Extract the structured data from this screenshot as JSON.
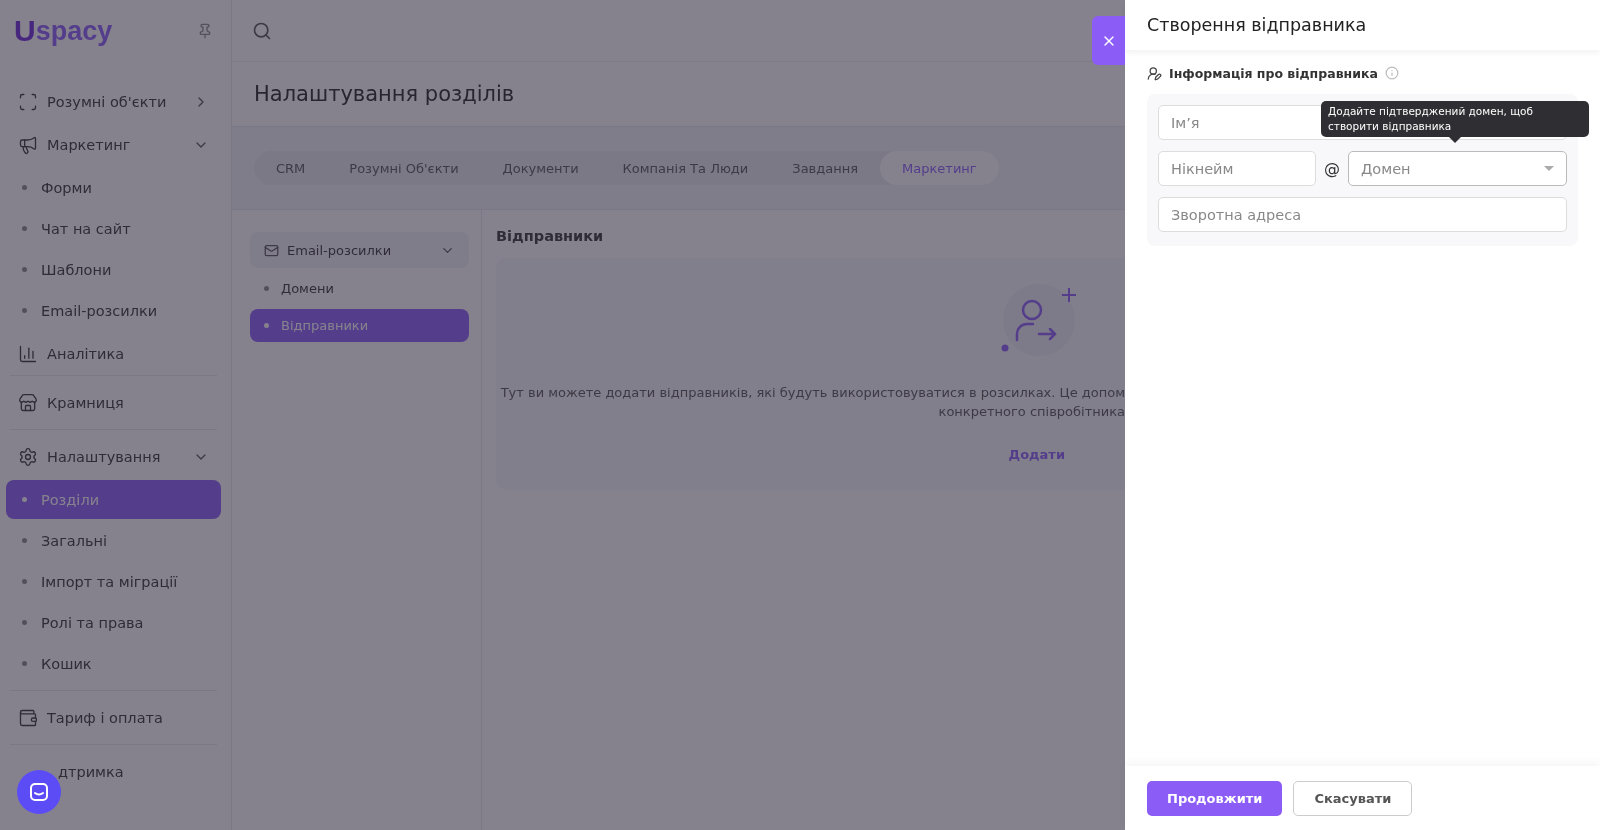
{
  "sidebar": {
    "logo": {
      "mark": "U",
      "text": "spacy"
    },
    "groups": [
      [
        {
          "kind": "objects",
          "label": "Розумні об'єкти",
          "expanded": false
        },
        {
          "kind": "marketing",
          "label": "Маркетинг",
          "expanded": true,
          "children": [
            {
              "label": "Форми",
              "selected": false
            },
            {
              "label": "Чат на сайт",
              "selected": false
            },
            {
              "label": "Шаблони",
              "selected": false
            },
            {
              "label": "Email-розсилки",
              "selected": false
            }
          ]
        },
        {
          "kind": "analytics",
          "label": "Аналітика"
        }
      ],
      [
        {
          "kind": "store",
          "label": "Крамниця"
        }
      ],
      [
        {
          "kind": "settings",
          "label": "Налаштування",
          "expanded": true,
          "children": [
            {
              "label": "Розділи",
              "selected": true
            },
            {
              "label": "Загальні",
              "selected": false
            },
            {
              "label": "Імпорт та міграції",
              "selected": false
            },
            {
              "label": "Ролі та права",
              "selected": false
            },
            {
              "label": "Кошик",
              "selected": false
            }
          ]
        }
      ],
      [
        {
          "kind": "wallet",
          "label": "Тариф і оплата"
        }
      ],
      [
        {
          "kind": "support",
          "label": "дтримка"
        }
      ]
    ]
  },
  "main": {
    "title": "Налаштування розділів",
    "tabs": [
      {
        "label": "CRM",
        "selected": false
      },
      {
        "label": "Розумні Об'єкти",
        "selected": false
      },
      {
        "label": "Документи",
        "selected": false
      },
      {
        "label": "Компанія Та Люди",
        "selected": false
      },
      {
        "label": "Завдання",
        "selected": false
      },
      {
        "label": "Маркетинг",
        "selected": true
      }
    ],
    "subnav": {
      "dropdown": "Email-розсилки",
      "items": [
        {
          "label": "Домени",
          "selected": false
        },
        {
          "label": "Відправники",
          "selected": true
        }
      ]
    },
    "section_title": "Відправники",
    "empty_state": {
      "lines": [
        "Тут ви можете додати відправників, які будуть використовуватися в розсилках. Це допом",
        "конкретного співробітника"
      ],
      "action": "Додати"
    }
  },
  "drawer": {
    "title": "Створення відправника",
    "section": {
      "title": "Інформація про відправника",
      "name": {
        "placeholder": "Ім’я"
      },
      "nickname": {
        "placeholder": "Нікнейм"
      },
      "at": "@",
      "domain": {
        "placeholder": "Домен"
      },
      "reply_to": {
        "placeholder": "Зворотна адреса"
      }
    },
    "tooltip": "Додайте підтверджений домен, щоб створити відправника",
    "buttons": {
      "primary": "Продовжити",
      "secondary": "Скасувати"
    }
  }
}
